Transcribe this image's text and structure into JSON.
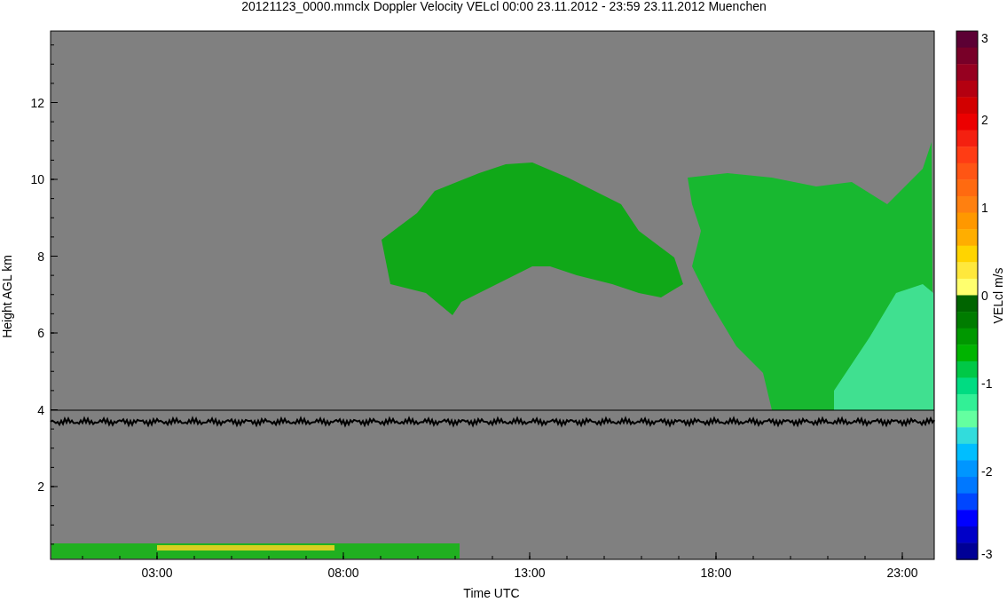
{
  "title": "20121123_0000.mmclx Doppler Velocity VELcl   00:00 23.11.2012 - 23:59 23.11.2012 Muenchen",
  "plot": {
    "ylabel": "Height AGL km",
    "xlabel": "Time UTC",
    "yticks": [
      "12",
      "10",
      "8",
      "6",
      "4",
      "2"
    ],
    "xticks": [
      "03:00",
      "08:00",
      "13:00",
      "18:00",
      "23:00"
    ]
  },
  "colorbar": {
    "label": "VELcl m/s",
    "ticks": [
      "3",
      "2",
      "1",
      "0",
      "-1",
      "-2",
      "-3"
    ],
    "segments": [
      {
        "color": "#5c0034"
      },
      {
        "color": "#780028"
      },
      {
        "color": "#960020"
      },
      {
        "color": "#b40010"
      },
      {
        "color": "#d20000"
      },
      {
        "color": "#ec0000"
      },
      {
        "color": "#f42010"
      },
      {
        "color": "#ff3c14"
      },
      {
        "color": "#ff5514"
      },
      {
        "color": "#ff6a10"
      },
      {
        "color": "#ff8010"
      },
      {
        "color": "#ff9800"
      },
      {
        "color": "#ffae00"
      },
      {
        "color": "#ffd400"
      },
      {
        "color": "#ffe83c"
      },
      {
        "color": "#ffff6e"
      },
      {
        "color": "#006400"
      },
      {
        "color": "#007c00"
      },
      {
        "color": "#009800"
      },
      {
        "color": "#00b400"
      },
      {
        "color": "#00c846"
      },
      {
        "color": "#00dc82"
      },
      {
        "color": "#32f096"
      },
      {
        "color": "#64ffa0"
      },
      {
        "color": "#32dcdc"
      },
      {
        "color": "#00beff"
      },
      {
        "color": "#0096ff"
      },
      {
        "color": "#0078ff"
      },
      {
        "color": "#0046ff"
      },
      {
        "color": "#0000ff"
      },
      {
        "color": "#0000c8"
      },
      {
        "color": "#000096"
      }
    ]
  }
}
